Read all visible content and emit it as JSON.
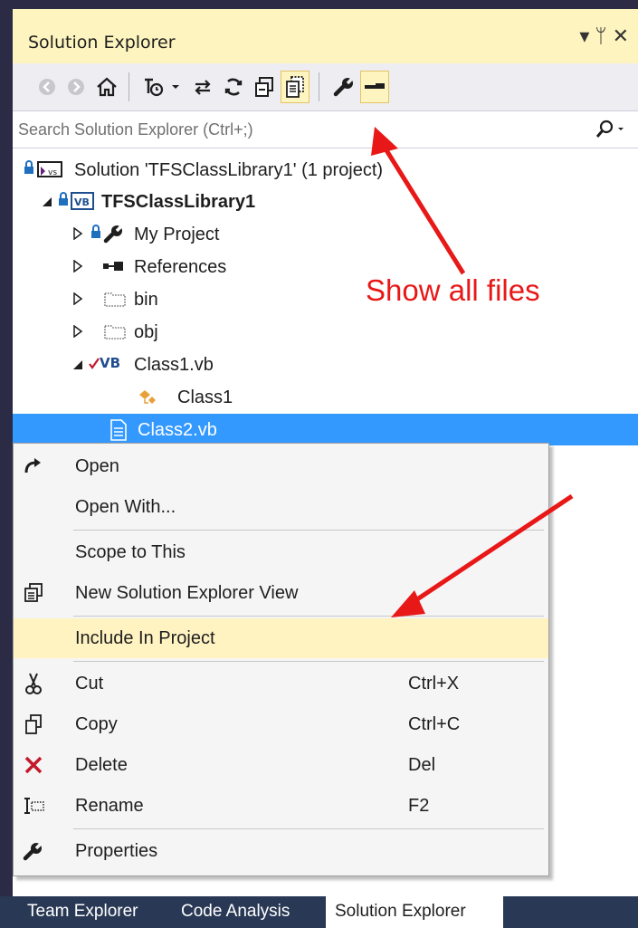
{
  "panel": {
    "title": "Solution Explorer",
    "controls": "▾ ⊥ ✕"
  },
  "toolbar": {
    "icons": [
      "back-icon",
      "forward-icon",
      "home-icon",
      "pending-changes-icon",
      "sync-icon",
      "refresh-icon",
      "collapse-all-icon",
      "show-all-files-icon",
      "properties-icon",
      "preview-icon"
    ]
  },
  "search": {
    "placeholder": "Search Solution Explorer (Ctrl+;)"
  },
  "tree": {
    "solution": "Solution 'TFSClassLibrary1' (1 project)",
    "project": "TFSClassLibrary1",
    "items": {
      "my_project": "My Project",
      "references": "References",
      "bin": "bin",
      "obj": "obj",
      "class1_file": "Class1.vb",
      "class1": "Class1",
      "class2_file": "Class2.vb"
    },
    "vb_badge": "VB"
  },
  "context_menu": {
    "open": "Open",
    "open_with": "Open With...",
    "scope": "Scope to This",
    "new_view": "New Solution Explorer View",
    "include": "Include In Project",
    "cut": "Cut",
    "cut_shortcut": "Ctrl+X",
    "copy": "Copy",
    "copy_shortcut": "Ctrl+C",
    "delete": "Delete",
    "delete_shortcut": "Del",
    "rename": "Rename",
    "rename_shortcut": "F2",
    "properties": "Properties"
  },
  "tabs": {
    "team_explorer": "Team Explorer",
    "code_analysis": "Code Analysis",
    "solution_explorer": "Solution Explorer"
  },
  "annotation": {
    "text": "Show all files",
    "color": "#e81818"
  },
  "colors": {
    "title_bg": "#fdf4bf",
    "selection": "#3399ff",
    "highlight": "#fff3c2",
    "frame": "#2b2b45"
  }
}
